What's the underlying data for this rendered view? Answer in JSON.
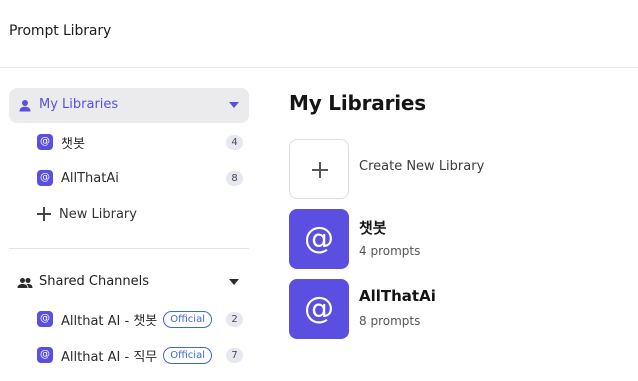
{
  "header": {
    "title": "Prompt Library"
  },
  "sidebar": {
    "my_libraries": {
      "label": "My Libraries",
      "items": [
        {
          "name": "챗봇",
          "count": "4"
        },
        {
          "name": "AllThatAi",
          "count": "8"
        }
      ],
      "new_library_label": "New Library"
    },
    "shared_channels": {
      "label": "Shared Channels",
      "items": [
        {
          "name": "Allthat AI - 챗봇",
          "badge": "Official",
          "count": "2"
        },
        {
          "name": "Allthat AI - 직무",
          "badge": "Official",
          "count": "7"
        }
      ]
    }
  },
  "main": {
    "title": "My Libraries",
    "create_label": "Create New Library",
    "libraries": [
      {
        "name": "챗봇",
        "subtitle": "4 prompts"
      },
      {
        "name": "AllThatAi",
        "subtitle": "8 prompts"
      }
    ]
  },
  "colors": {
    "accent": "#5a4fe0",
    "badge": "#3f68d9"
  },
  "icons": {
    "library_logo": "at-sign-icon",
    "my_libraries": "person-icon",
    "shared_channels": "people-icon"
  }
}
